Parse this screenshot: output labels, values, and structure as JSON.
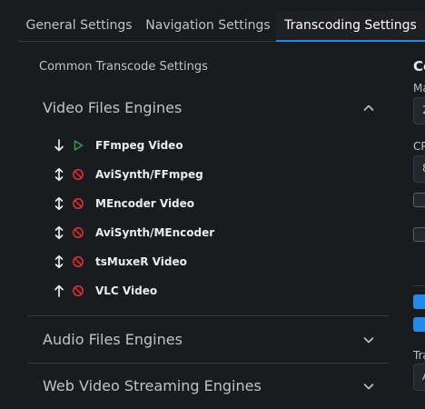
{
  "tabs": [
    {
      "label": "General Settings",
      "active": false
    },
    {
      "label": "Navigation Settings",
      "active": false
    },
    {
      "label": "Transcoding Settings",
      "active": true
    }
  ],
  "common_transcode_label": "Common Transcode Settings",
  "video_engines": {
    "label": "Video Files Engines",
    "expanded": true,
    "items": [
      {
        "name": "FFmpeg Video",
        "arrow": "down-arrow-icon",
        "status": "play-icon"
      },
      {
        "name": "AviSynth/FFmpeg",
        "arrow": "up-down-arrow-icon",
        "status": "disabled-icon"
      },
      {
        "name": "MEncoder Video",
        "arrow": "up-down-arrow-icon",
        "status": "disabled-icon"
      },
      {
        "name": "AviSynth/MEncoder",
        "arrow": "up-down-arrow-icon",
        "status": "disabled-icon"
      },
      {
        "name": "tsMuxeR Video",
        "arrow": "up-down-arrow-icon",
        "status": "disabled-icon"
      },
      {
        "name": "VLC Video",
        "arrow": "up-arrow-icon",
        "status": "disabled-icon"
      }
    ]
  },
  "audio_engines": {
    "label": "Audio Files Engines",
    "expanded": false
  },
  "web_engines": {
    "label": "Web Video Streaming Engines",
    "expanded": false
  },
  "right_panel": {
    "title": "Co",
    "label1": "Ma",
    "value1": "2",
    "label2": "CP",
    "value2": "8",
    "label3": "Tra",
    "value3": "A"
  },
  "colors": {
    "accent": "#228be6",
    "play": "#2f9e44",
    "disabled": "#e03131"
  }
}
